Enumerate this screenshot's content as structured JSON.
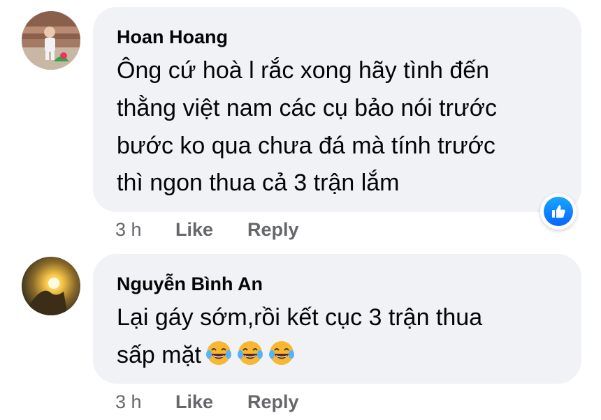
{
  "comments": [
    {
      "author": "Hoan Hoang",
      "lines": [
        "Ông cứ hoà l rắc xong hãy tình đến",
        "thằng việt nam các cụ bảo nói trước",
        "bước ko qua chưa đá mà tính trước",
        "thì ngon thua cả 3 trận lắm"
      ],
      "time": "3 h",
      "like_label": "Like",
      "reply_label": "Reply",
      "reaction_icon": "like-reaction-icon"
    },
    {
      "author": "Nguyễn Bình An",
      "lines": [
        "Lại gáy sớm,rồi kết cục 3 trận thua",
        "sấp mặt"
      ],
      "emoji_icon": "laughing-tears-emoji",
      "emoji_count": 3,
      "time": "3 h",
      "like_label": "Like",
      "reply_label": "Reply"
    }
  ],
  "colors": {
    "bubble": "#f0f2f5",
    "text": "#050505",
    "meta": "#65676b",
    "like_blue": "#0866ff"
  }
}
